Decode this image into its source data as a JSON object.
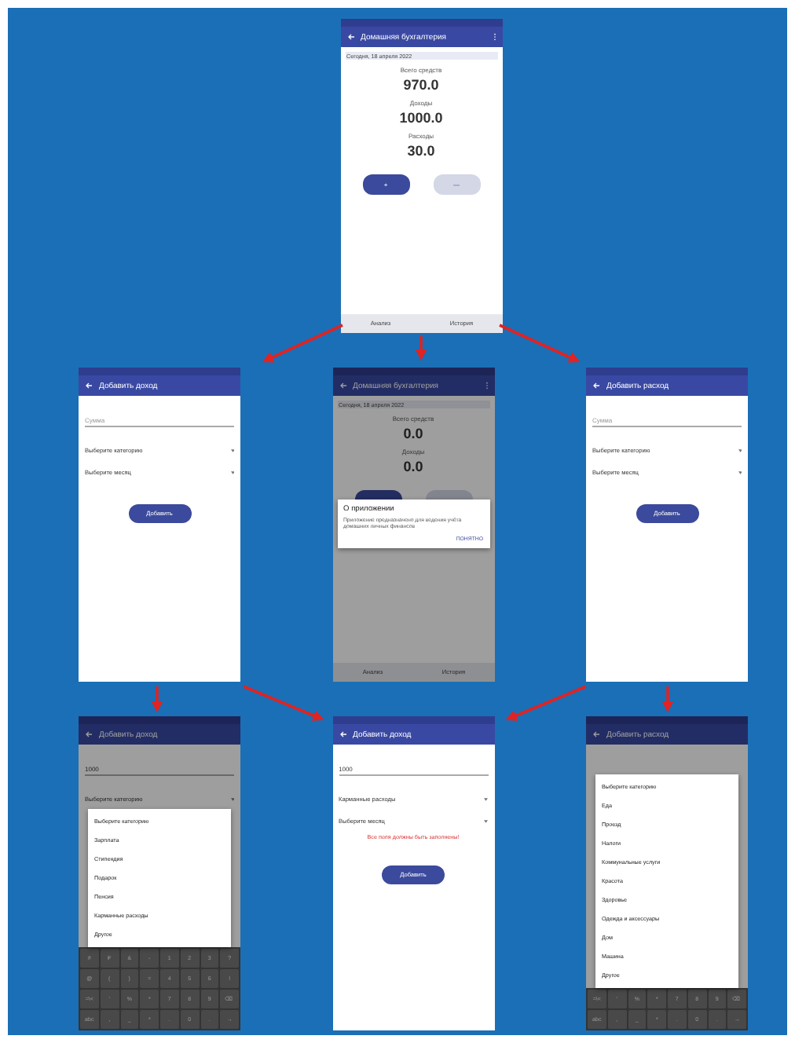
{
  "screens": [
    {
      "kind": "home",
      "dimmed": false,
      "title": "Домашняя бухгалтерия",
      "date": "Сегодня, 18 апреля 2022",
      "stats": [
        {
          "label": "Всего средств",
          "value": "970.0"
        },
        {
          "label": "Доходы",
          "value": "1000.0"
        },
        {
          "label": "Расходы",
          "value": "30.0"
        }
      ],
      "buttons": [
        {
          "label": "+",
          "disabled": false
        },
        {
          "label": "—",
          "disabled": true
        }
      ],
      "nav": [
        "Анализ",
        "История"
      ]
    },
    {
      "kind": "form",
      "dimmed": false,
      "title": "Добавить доход",
      "amount": {
        "placeholder": "Сумма"
      },
      "selects": [
        "Выберите категорию",
        "Выберите месяц"
      ],
      "button": "Добавить"
    },
    {
      "kind": "home",
      "dimmed": true,
      "title": "Домашняя бухгалтерия",
      "date": "Сегодня, 18 апреля 2022",
      "stats": [
        {
          "label": "Всего средств",
          "value": "0.0"
        },
        {
          "label": "Доходы",
          "value": "0.0"
        }
      ],
      "buttons": [
        {
          "disabled": false
        },
        {
          "disabled": true
        }
      ],
      "nav": [
        "Анализ",
        "История"
      ],
      "dialog": {
        "title": "О приложении",
        "text": "Приложение предназначено для ведения учёта домашних личных финансов",
        "action": "ПОНЯТНО"
      }
    },
    {
      "kind": "form",
      "dimmed": false,
      "title": "Добавить расход",
      "amount": {
        "placeholder": "Сумма"
      },
      "selects": [
        "Выберите категорию",
        "Выберите месяц"
      ],
      "button": "Добавить"
    },
    {
      "kind": "form",
      "dimmed": true,
      "title": "Добавить доход",
      "amount": {
        "value": "1000"
      },
      "selects": [
        "Выберите категорию"
      ],
      "dropdown": [
        "Выберите категорию",
        "Зарплата",
        "Стипендия",
        "Подарок",
        "Пенсия",
        "Карманные расходы",
        "Другое"
      ],
      "keyboard": [
        [
          "#",
          "₽",
          "&",
          "-",
          "1",
          "2",
          "3",
          "?"
        ],
        [
          "@",
          "(",
          ")",
          "=",
          "4",
          "5",
          "6",
          "!"
        ],
        [
          "=\\<",
          "'",
          "%",
          "*",
          "7",
          "8",
          "9",
          "⌫"
        ],
        [
          "abc",
          ",",
          "_",
          "*",
          ".",
          "0",
          ".",
          "→"
        ]
      ]
    },
    {
      "kind": "form",
      "dimmed": false,
      "title": "Добавить доход",
      "amount": {
        "value": "1000"
      },
      "selects": [
        "Карманные расходы",
        "Выберите месяц"
      ],
      "error": "Все поля должны быть заполнены!",
      "button": "Добавить"
    },
    {
      "kind": "form",
      "dimmed": true,
      "title": "Добавить расход",
      "dropdown": [
        "Выберите категорию",
        "Еда",
        "Проезд",
        "Налоги",
        "Коммунальные услуги",
        "Красота",
        "Здоровье",
        "Одежда и аксессуары",
        "Дом",
        "Машина",
        "Другое"
      ],
      "keyboard": [
        [
          "=\\<",
          "'",
          "%",
          "*",
          "7",
          "8",
          "9",
          "⌫"
        ],
        [
          "abc",
          ",",
          "_",
          "*",
          ".",
          "0",
          ".",
          "→"
        ]
      ]
    }
  ]
}
